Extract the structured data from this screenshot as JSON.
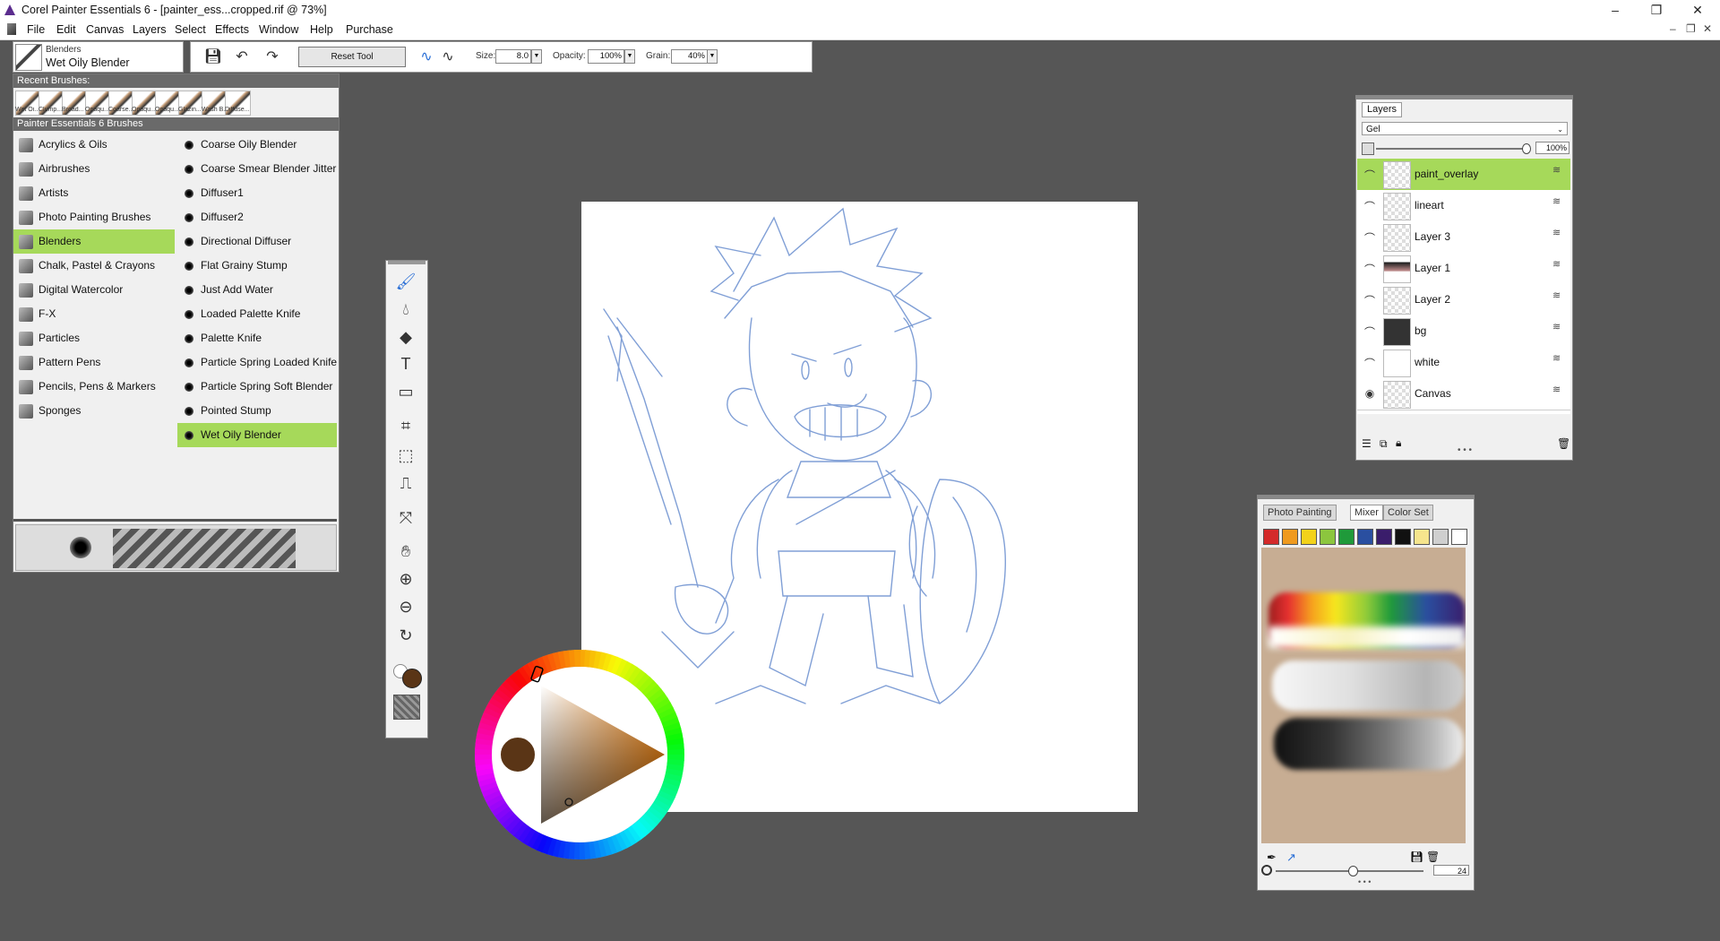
{
  "window": {
    "title": "Corel Painter Essentials 6 - [painter_ess...cropped.rif @ 73%]",
    "controls": [
      "–",
      "❐",
      "✕"
    ],
    "doc_controls": [
      "–",
      "❐",
      "✕"
    ]
  },
  "menu": [
    "File",
    "Edit",
    "Canvas",
    "Layers",
    "Select",
    "Effects",
    "Window",
    "Help",
    "Purchase"
  ],
  "brush_selector": {
    "category": "Blenders",
    "variant": "Wet Oily Blender"
  },
  "property_bar": {
    "reset_label": "Reset Tool",
    "size_label": "Size:",
    "size_value": "8.0",
    "opacity_label": "Opacity:",
    "opacity_value": "100%",
    "grain_label": "Grain:",
    "grain_value": "40%"
  },
  "brush_library": {
    "recent_header": "Recent Brushes:",
    "recent": [
      "Wet Oi...",
      "Clump...",
      "Broad...",
      "Opaqu...",
      "Coarse...",
      "Opaqu...",
      "Opaqu...",
      "Glazin...",
      "Wash B...",
      "Diffuse..."
    ],
    "library_header": "Painter Essentials 6 Brushes",
    "categories": [
      "Acrylics & Oils",
      "Airbrushes",
      "Artists",
      "Photo Painting Brushes",
      "Blenders",
      "Chalk, Pastel & Crayons",
      "Digital Watercolor",
      "F-X",
      "Particles",
      "Pattern Pens",
      "Pencils, Pens & Markers",
      "Sponges"
    ],
    "selected_category": "Blenders",
    "variants": [
      "Coarse Oily Blender",
      "Coarse Smear Blender Jitter",
      "Diffuser1",
      "Diffuser2",
      "Directional Diffuser",
      "Flat Grainy Stump",
      "Just Add Water",
      "Loaded Palette Knife",
      "Palette Knife",
      "Particle Spring Loaded Knife",
      "Particle Spring Soft Blender",
      "Pointed Stump",
      "Wet Oily Blender"
    ],
    "selected_variant": "Wet Oily Blender"
  },
  "toolbox": [
    "brush-icon",
    "dropper-icon",
    "paint-bucket-icon",
    "text-icon",
    "eraser-icon",
    "crop-icon",
    "rect-select-icon",
    "clone-stamp-icon",
    "transform-icon",
    "grabber-hand-icon",
    "zoom-in-icon",
    "zoom-out-icon",
    "rotate-icon"
  ],
  "layers": {
    "tab": "Layers",
    "composite": "Gel",
    "opacity": "100%",
    "opacity_fraction": 1.0,
    "items": [
      {
        "name": "paint_overlay",
        "selected": true
      },
      {
        "name": "lineart"
      },
      {
        "name": "Layer 3"
      },
      {
        "name": "Layer 1"
      },
      {
        "name": "Layer 2"
      },
      {
        "name": "bg"
      },
      {
        "name": "white"
      },
      {
        "name": "Canvas"
      }
    ]
  },
  "mixer": {
    "tabs": [
      "Photo Painting",
      "Mixer",
      "Color Set"
    ],
    "active_tab": "Mixer",
    "swatches": [
      "#d42a2a",
      "#f09a1e",
      "#f3d21a",
      "#8cc63e",
      "#1f9a3a",
      "#2a4fa0",
      "#3a1d6b",
      "#111111",
      "#f6e58d",
      "#cfcfcf",
      "#ffffff"
    ],
    "brush_size": "24",
    "pad_color": "#c7ad93"
  },
  "color": {
    "current": "#5a3516",
    "hue_color": "#f08a1e"
  }
}
